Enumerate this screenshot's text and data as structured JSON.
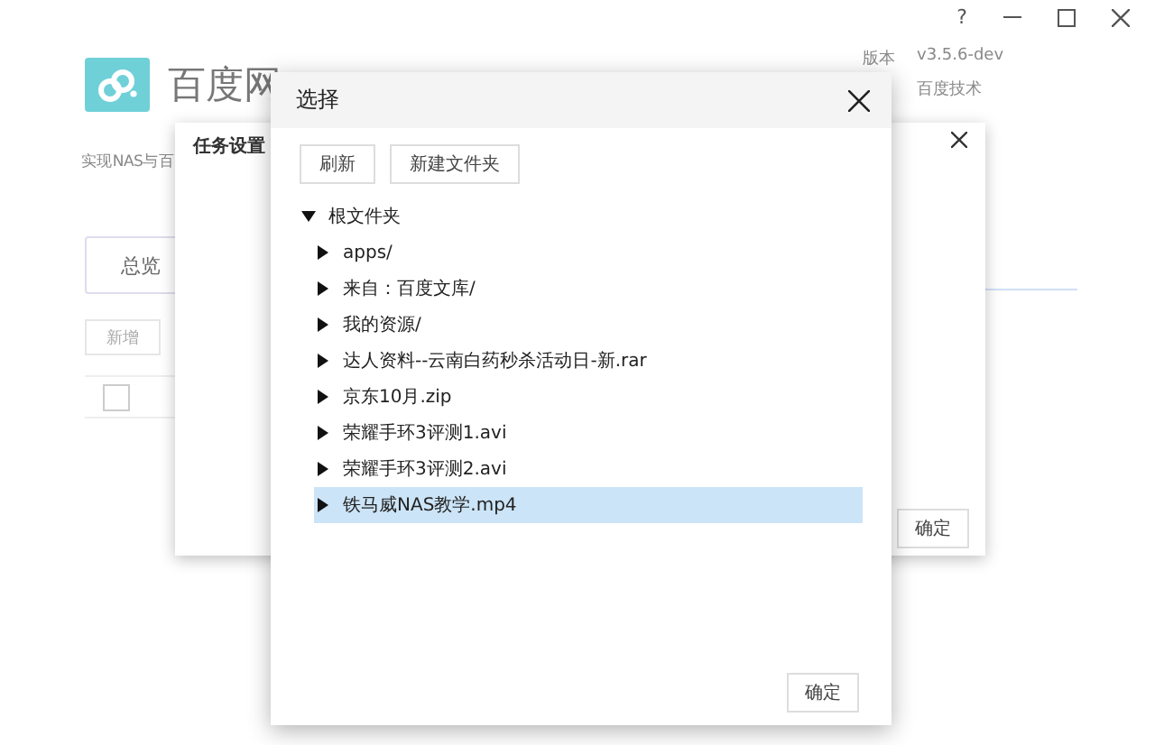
{
  "window_controls": {
    "help": "?"
  },
  "app": {
    "title": "百度网",
    "subtitle": "实现NAS与百",
    "info": [
      {
        "label": "版本",
        "value": "v3.5.6-dev"
      },
      {
        "value": "百度技术"
      }
    ],
    "tabs": [
      {
        "label": "总览",
        "selected": false
      }
    ],
    "add_button": "新增",
    "select_all_checked": false
  },
  "task_dialog": {
    "title": "任务设置",
    "confirm": "确定"
  },
  "select_dialog": {
    "title": "选择",
    "buttons": [
      "刷新",
      "新建文件夹"
    ],
    "tree": {
      "label": "根文件夹",
      "expanded": true,
      "children": [
        {
          "label": "apps/",
          "expanded": false,
          "selected": false
        },
        {
          "label": "来自：百度文库/",
          "expanded": false,
          "selected": false
        },
        {
          "label": "我的资源/",
          "expanded": false,
          "selected": false
        },
        {
          "label": "达人资料--云南白药秒杀活动日-新.rar",
          "expanded": false,
          "selected": false
        },
        {
          "label": "京东10月.zip",
          "expanded": false,
          "selected": false
        },
        {
          "label": "荣耀手环3评测1.avi",
          "expanded": false,
          "selected": false
        },
        {
          "label": "荣耀手环3评测2.avi",
          "expanded": false,
          "selected": false
        },
        {
          "label": "铁马威NAS教学.mp4",
          "expanded": false,
          "selected": true
        }
      ]
    },
    "confirm": "确定"
  }
}
